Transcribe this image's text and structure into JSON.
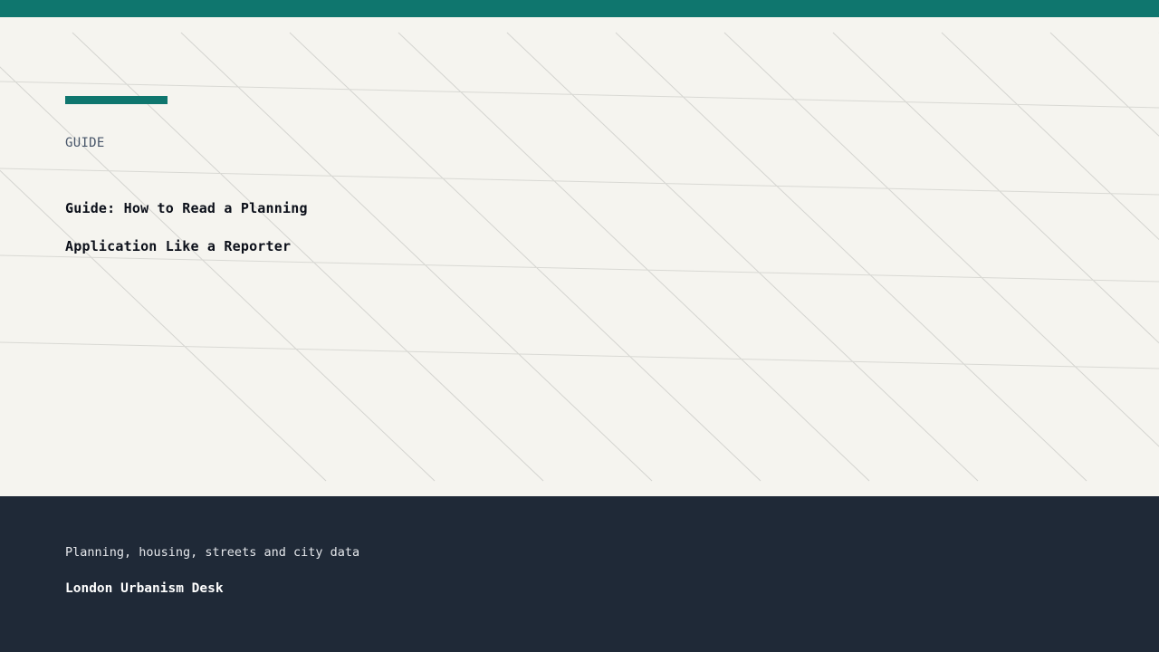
{
  "colors": {
    "accent": "#0f766e",
    "hero_background": "#f5f4ef",
    "footer_background": "#1f2937",
    "pattern_line": "#d4d4d0"
  },
  "article": {
    "category": "GUIDE",
    "title": "Guide: How to Read a Planning Application Like a Reporter"
  },
  "footer": {
    "tagline": "Planning, housing, streets and city data",
    "brand": "London Urbanism Desk"
  }
}
